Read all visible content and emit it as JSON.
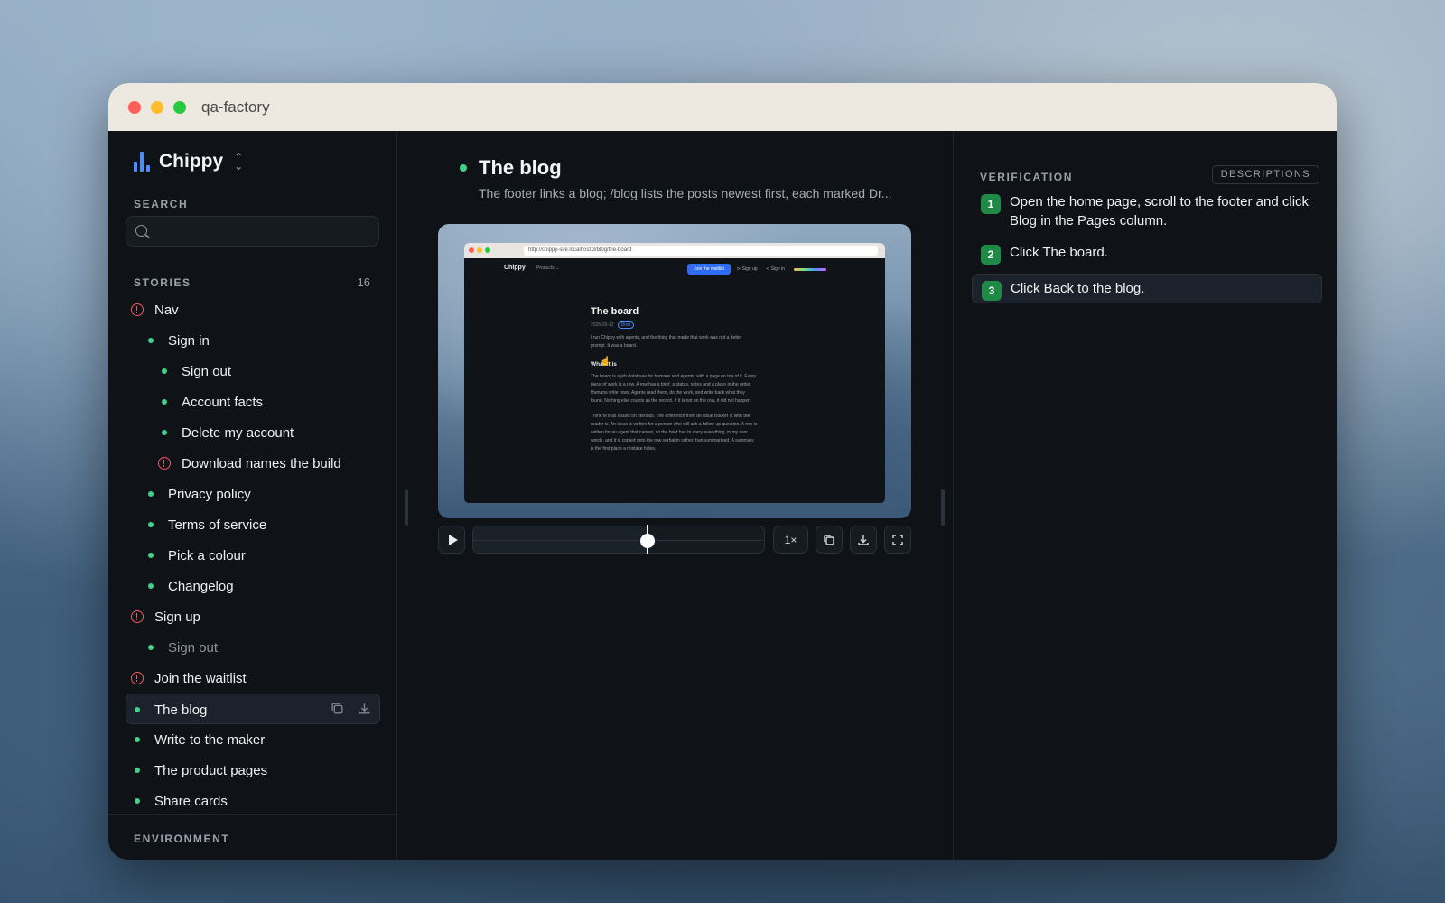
{
  "window": {
    "title": "qa-factory"
  },
  "sidebar": {
    "brand": "Chippy",
    "search_label": "SEARCH",
    "search_placeholder": "",
    "stories_label": "STORIES",
    "stories_count": "16",
    "environment_label": "ENVIRONMENT",
    "stories": [
      {
        "label": "Nav",
        "status": "warn",
        "indent": 0
      },
      {
        "label": "Sign in",
        "status": "ok",
        "indent": 1
      },
      {
        "label": "Sign out",
        "status": "ok",
        "indent": 2
      },
      {
        "label": "Account facts",
        "status": "ok",
        "indent": 2
      },
      {
        "label": "Delete my account",
        "status": "ok",
        "indent": 2
      },
      {
        "label": "Download names the build",
        "status": "warn",
        "indent": 2
      },
      {
        "label": "Privacy policy",
        "status": "ok",
        "indent": 1
      },
      {
        "label": "Terms of service",
        "status": "ok",
        "indent": 1
      },
      {
        "label": "Pick a colour",
        "status": "ok",
        "indent": 1
      },
      {
        "label": "Changelog",
        "status": "ok",
        "indent": 1
      },
      {
        "label": "Sign up",
        "status": "warn",
        "indent": 0
      },
      {
        "label": "Sign out",
        "status": "ok",
        "indent": 1,
        "muted": true
      },
      {
        "label": "Join the waitlist",
        "status": "warn",
        "indent": 0
      },
      {
        "label": "The blog",
        "status": "ok",
        "indent": 0,
        "selected": true
      },
      {
        "label": "Write to the maker",
        "status": "ok",
        "indent": 0
      },
      {
        "label": "The product pages",
        "status": "ok",
        "indent": 0
      },
      {
        "label": "Share cards",
        "status": "ok",
        "indent": 0
      }
    ]
  },
  "main": {
    "title": "The blog",
    "description": "The footer links a blog; /blog lists the posts newest first, each marked Dr...",
    "preview": {
      "url": "http://chippy-site.localhost:3/blog/the-board",
      "brand": "Chippy",
      "products": "Products ⌄",
      "cta": "Join the waitlist",
      "sign_up": "⊳ Sign up",
      "sign_in": "⊲ Sign in",
      "article_title": "The board",
      "article_date": "2026-05-12",
      "article_tag": "Draft",
      "intro": "I run Chippy with agents, and the thing that made that work was not a better prompt. It was a board.",
      "section_heading": "What it is",
      "para1": "The board is a job database for humans and agents, with a page on top of it. Every piece of work is a row. A row has a brief, a status, notes and a place in the order. Humans write rows. Agents read them, do the work, and write back what they found. Nothing else counts as the record. If it is not on the row, it did not happen.",
      "para2": "Think of it as issues on steroids. The difference from an issue tracker is who the reader is. An issue is written for a person who will ask a follow-up question. A row is written for an agent that cannot, so the brief has to carry everything, in my own words, and it is copied onto the row verbatim rather than summarised. A summary is the first place a mistake hides."
    },
    "playback": {
      "speed": "1×",
      "progress": 0.6
    }
  },
  "verification": {
    "label": "VERIFICATION",
    "descriptions_button": "DESCRIPTIONS",
    "steps": [
      {
        "num": "1",
        "text": "Open the home page, scroll to the footer and click Blog in the Pages column."
      },
      {
        "num": "2",
        "text": "Click The board."
      },
      {
        "num": "3",
        "text": "Click Back to the blog.",
        "active": true
      }
    ]
  }
}
